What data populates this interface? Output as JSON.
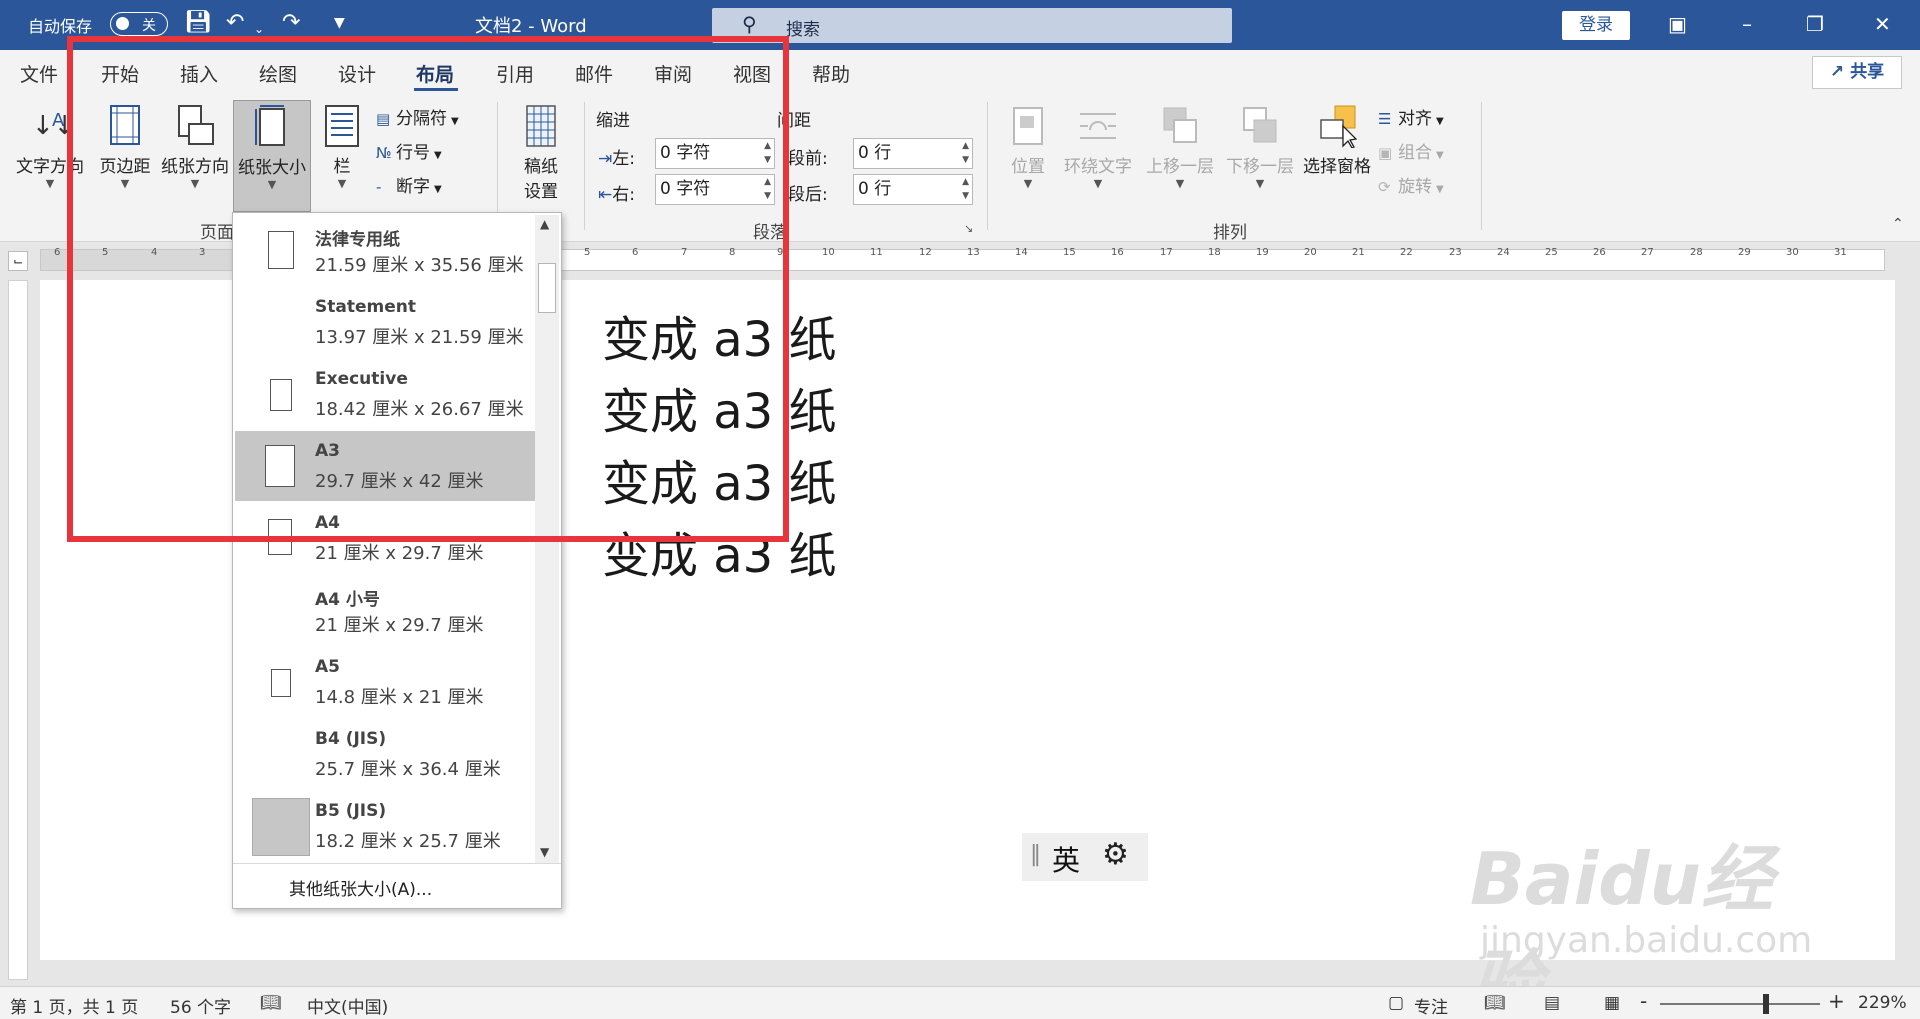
{
  "titlebar": {
    "autosave_label": "自动保存",
    "autosave_toggle": "关",
    "doc_title": "文档2  -  Word",
    "search_placeholder": "搜索",
    "login_label": "登录"
  },
  "tabs": [
    {
      "label": "文件"
    },
    {
      "label": "开始"
    },
    {
      "label": "插入"
    },
    {
      "label": "绘图"
    },
    {
      "label": "设计"
    },
    {
      "label": "布局",
      "active": true
    },
    {
      "label": "引用"
    },
    {
      "label": "邮件"
    },
    {
      "label": "审阅"
    },
    {
      "label": "视图"
    },
    {
      "label": "帮助"
    }
  ],
  "share_label": "共享",
  "ribbon": {
    "page_setup": {
      "text_direction": "文字方向",
      "margins": "页边距",
      "orientation": "纸张方向",
      "size": "纸张大小",
      "columns": "栏",
      "breaks": "分隔符",
      "line_numbers": "行号",
      "hyphenation": "断字",
      "group_label": "页面"
    },
    "manuscript": {
      "label_line1": "稿纸",
      "label_line2": "设置"
    },
    "indent": {
      "title": "缩进",
      "left_label": "左:",
      "left_value": "0 字符",
      "right_label": "右:",
      "right_value": "0 字符"
    },
    "spacing": {
      "title": "间距",
      "before_label": "段前:",
      "before_value": "0 行",
      "after_label": "段后:",
      "after_value": "0 行"
    },
    "paragraph_group_label": "段落",
    "arrange": {
      "position": "位置",
      "wrap_text": "环绕文字",
      "bring_forward": "上移一层",
      "send_backward": "下移一层",
      "selection_pane": "选择窗格",
      "align": "对齐",
      "group": "组合",
      "rotate": "旋转",
      "group_label": "排列"
    }
  },
  "ruler_numbers": [
    "6",
    "5",
    "4",
    "3",
    "5",
    "6",
    "7",
    "8",
    "9",
    "10",
    "11",
    "12",
    "13",
    "14",
    "15",
    "16",
    "17",
    "18",
    "19",
    "20",
    "21",
    "22",
    "23",
    "24",
    "25",
    "26",
    "27",
    "28",
    "29",
    "30",
    "31"
  ],
  "document": {
    "lines": [
      "变成 a3 纸",
      "变成 a3 纸",
      "变成 a3 纸",
      "变成 a3 纸"
    ]
  },
  "paper_sizes": [
    {
      "name": "法律专用纸",
      "dims": "21.59 厘米 x 35.56 厘米"
    },
    {
      "name": "Statement",
      "dims": "13.97 厘米 x 21.59 厘米"
    },
    {
      "name": "Executive",
      "dims": "18.42 厘米 x 26.67 厘米"
    },
    {
      "name": "A3",
      "dims": "29.7 厘米 x 42 厘米",
      "selected": true
    },
    {
      "name": "A4",
      "dims": "21 厘米 x 29.7 厘米"
    },
    {
      "name": "A4 小号",
      "dims": "21 厘米 x 29.7 厘米"
    },
    {
      "name": "A5",
      "dims": "14.8 厘米 x 21 厘米"
    },
    {
      "name": "B4 (JIS)",
      "dims": "25.7 厘米 x 36.4 厘米"
    },
    {
      "name": "B5 (JIS)",
      "dims": "18.2 厘米 x 25.7 厘米"
    }
  ],
  "more_paper_sizes": "其他纸张大小(A)...",
  "ime": {
    "mode": "英"
  },
  "status": {
    "page": "第 1 页，共 1 页",
    "words": "56 个字",
    "language": "中文(中国)",
    "focus": "专注",
    "zoom": "229%",
    "zoom_minus": "-",
    "zoom_plus": "+"
  },
  "watermark": {
    "brand": "Baidu经验",
    "url": "jingyan.baidu.com"
  },
  "colors": {
    "accent": "#2b579a",
    "annotation": "#e8353b",
    "selected": "#c6c6c6"
  }
}
